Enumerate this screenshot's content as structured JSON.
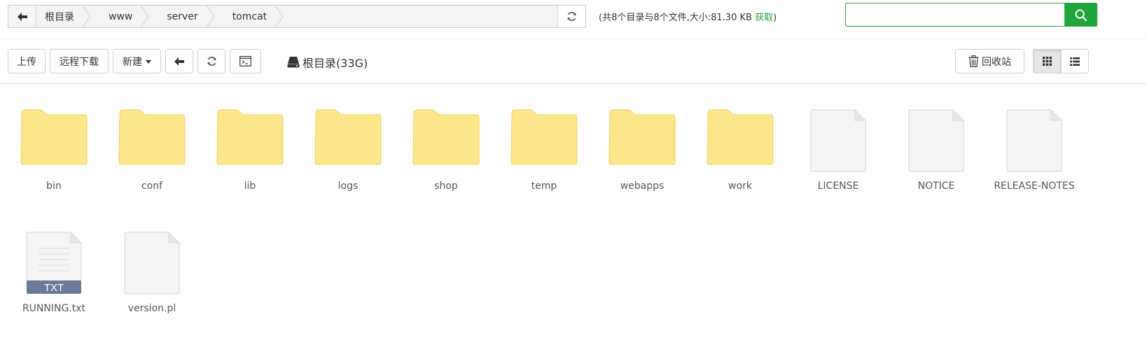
{
  "pathbar": {
    "crumbs": [
      {
        "label": "根目录"
      },
      {
        "label": "www"
      },
      {
        "label": "server"
      },
      {
        "label": "tomcat"
      }
    ]
  },
  "summary": {
    "text": "(共8个目录与8个文件,大小:81.30 KB ",
    "get_label": "获取",
    "close": ")"
  },
  "search": {
    "value": "",
    "placeholder": ""
  },
  "toolbar": {
    "upload_label": "上传",
    "remote_download_label": "远程下载",
    "new_label": "新建",
    "disk_label": "根目录(33G)",
    "recycle_label": "回收站"
  },
  "files": [
    {
      "name": "bin",
      "type": "folder"
    },
    {
      "name": "conf",
      "type": "folder"
    },
    {
      "name": "lib",
      "type": "folder"
    },
    {
      "name": "logs",
      "type": "folder"
    },
    {
      "name": "shop",
      "type": "folder"
    },
    {
      "name": "temp",
      "type": "folder"
    },
    {
      "name": "webapps",
      "type": "folder"
    },
    {
      "name": "work",
      "type": "folder"
    },
    {
      "name": "LICENSE",
      "type": "file"
    },
    {
      "name": "NOTICE",
      "type": "file"
    },
    {
      "name": "RELEASE-NOTES",
      "type": "file"
    },
    {
      "name": "RUNNING.txt",
      "type": "txt",
      "badge": "TXT"
    },
    {
      "name": "version.pl",
      "type": "file"
    }
  ],
  "colors": {
    "accent": "#20a53a",
    "folder": "#fde68a",
    "folder_edge": "#f1cf62",
    "txt_badge": "#6b7a9b"
  },
  "icons": {
    "back": "arrow-left-icon",
    "refresh": "refresh-icon",
    "search": "search-icon",
    "terminal": "terminal-icon",
    "disk": "hdd-icon",
    "recycle": "trash-icon",
    "grid_view": "grid-view-icon",
    "list_view": "list-view-icon"
  }
}
